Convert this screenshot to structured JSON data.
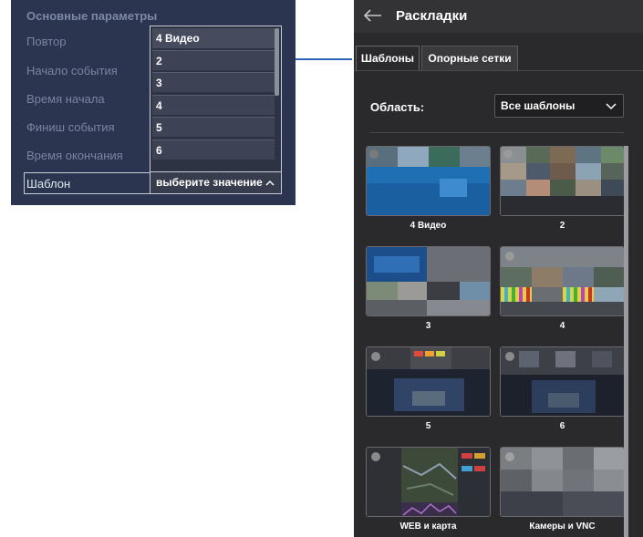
{
  "left_panel": {
    "section_title": "Основные параметры",
    "fields": [
      {
        "label": "Повтор"
      },
      {
        "label": "Начало события"
      },
      {
        "label": "Время начала"
      },
      {
        "label": "Финиш события"
      },
      {
        "label": "Время окончания"
      },
      {
        "label": "Шаблон"
      }
    ],
    "dropdown_options": [
      "4 Видео",
      "2",
      "3",
      "4",
      "5",
      "6"
    ],
    "select_placeholder": "выберите значение",
    "chevron_icon": "chevron-up-icon"
  },
  "right_panel": {
    "back_icon": "arrow-left-icon",
    "title": "Раскладки",
    "tabs": [
      {
        "label": "Шаблоны",
        "active": true
      },
      {
        "label": "Опорные сетки",
        "active": false
      }
    ],
    "area_label": "Область:",
    "area_value": "Все шаблоны",
    "templates": [
      {
        "label": "4 Видео"
      },
      {
        "label": "2"
      },
      {
        "label": "3"
      },
      {
        "label": "4"
      },
      {
        "label": "5"
      },
      {
        "label": "6"
      },
      {
        "label": "WEB и карта"
      },
      {
        "label": "Камеры и VNC"
      }
    ]
  },
  "colors": {
    "left_bg": "#2b3550",
    "right_bg": "#2a2a2c",
    "connector": "#2f65b8"
  }
}
